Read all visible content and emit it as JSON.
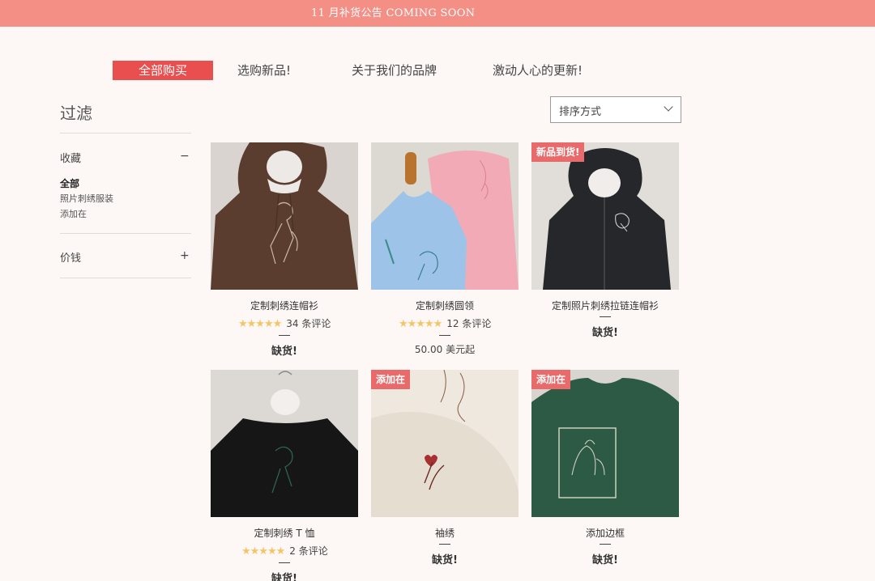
{
  "announcement": "11 月补货公告 COMING SOON",
  "nav": {
    "items": [
      "全部购买",
      "选购新品!",
      "关于我们的品牌",
      "激动人心的更新!"
    ]
  },
  "filter": {
    "title": "过滤",
    "collections": {
      "label": "收藏",
      "toggle": "−",
      "options": [
        "全部",
        "照片刺绣服装",
        "添加在"
      ]
    },
    "price": {
      "label": "价钱",
      "toggle": "+"
    }
  },
  "sort": {
    "label": "排序方式"
  },
  "products": [
    {
      "name": "定制刺绣连帽衫",
      "reviews": "34 条评论",
      "rating": 5,
      "status": "缺货!",
      "badge": ""
    },
    {
      "name": "定制刺绣圆领",
      "reviews": "12 条评论",
      "rating": 5,
      "price": "50.00 美元起",
      "badge": ""
    },
    {
      "name": "定制照片刺绣拉链连帽衫",
      "status": "缺货!",
      "badge": "新品到货!"
    },
    {
      "name": "定制刺绣 T 恤",
      "reviews": "2 条评论",
      "rating": 5,
      "status": "缺货!",
      "badge": ""
    },
    {
      "name": "袖绣",
      "status": "缺货!",
      "badge": "添加在"
    },
    {
      "name": "添加边框",
      "status": "缺货!",
      "badge": "添加在"
    }
  ],
  "colors": {
    "announcement_bg": "#f48f85",
    "nav_active_bg": "#e94f4f",
    "badge_bg": "#e86a6a",
    "star": "#f4c566",
    "page_bg": "#fdf8f5"
  }
}
